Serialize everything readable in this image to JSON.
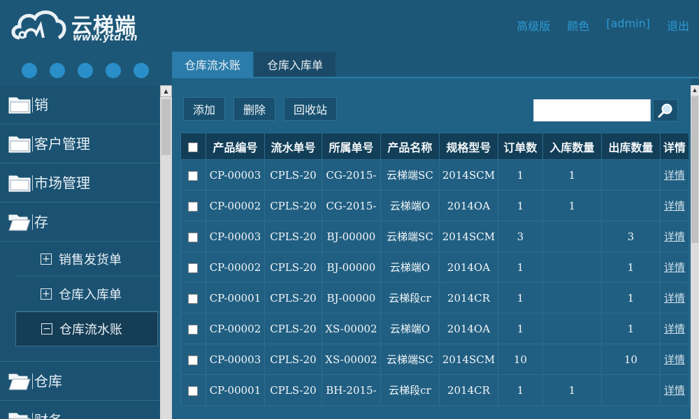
{
  "header": {
    "brand": "云梯端",
    "url": "www.ytd.cn",
    "nav": [
      "高级版",
      "颜色",
      "[admin]",
      "退出"
    ]
  },
  "sidebar": {
    "categories": [
      {
        "label": "销",
        "icon": "folder-closed-icon"
      },
      {
        "label": "客户管理",
        "icon": "folder-closed-icon"
      },
      {
        "label": "市场管理",
        "icon": "folder-closed-icon"
      },
      {
        "label": "存",
        "icon": "folder-open-icon"
      }
    ],
    "sub_items": [
      {
        "label": "销售发货单",
        "expand": "⊞"
      },
      {
        "label": "仓库入库单",
        "expand": "⊞"
      },
      {
        "label": "仓库流水账",
        "expand": "⊟"
      }
    ],
    "after": [
      {
        "label": "仓库",
        "icon": "folder-open-icon"
      },
      {
        "label": "财务",
        "icon": "folder-open-icon"
      }
    ]
  },
  "tabs": [
    "仓库流水账",
    "仓库入库单"
  ],
  "toolbar": {
    "add": "添加",
    "delete": "删除",
    "recycle": "回收站"
  },
  "search": {
    "placeholder": ""
  },
  "table": {
    "headers": [
      "产品编号",
      "流水单号",
      "所属单号",
      "产品名称",
      "规格型号",
      "订单数",
      "入库数量",
      "出库数量",
      "详情"
    ],
    "detail_label": "详情",
    "rows": [
      [
        "CP-00003",
        "CPLS-20",
        "CG-2015-",
        "云梯端SC",
        "2014SCM",
        "1",
        "1",
        ""
      ],
      [
        "CP-00002",
        "CPLS-20",
        "CG-2015-",
        "云梯端O",
        "2014OA",
        "1",
        "1",
        ""
      ],
      [
        "CP-00003",
        "CPLS-20",
        "BJ-00000",
        "云梯端SC",
        "2014SCM",
        "3",
        "",
        "3"
      ],
      [
        "CP-00002",
        "CPLS-20",
        "BJ-00000",
        "云梯端O",
        "2014OA",
        "1",
        "",
        "1"
      ],
      [
        "CP-00001",
        "CPLS-20",
        "BJ-00000",
        "云梯段cr",
        "2014CR",
        "1",
        "",
        "1"
      ],
      [
        "CP-00002",
        "CPLS-20",
        "XS-00002",
        "云梯端O",
        "2014OA",
        "1",
        "",
        "1"
      ],
      [
        "CP-00003",
        "CPLS-20",
        "XS-00002",
        "云梯端SC",
        "2014SCM",
        "10",
        "",
        "10"
      ],
      [
        "CP-00001",
        "CPLS-20",
        "BH-2015-",
        "云梯段cr",
        "2014CR",
        "1",
        "1",
        ""
      ]
    ]
  },
  "colors": {
    "accent": "#2c9ad5",
    "bg": "#1d5777",
    "header_row": "#123e58"
  }
}
